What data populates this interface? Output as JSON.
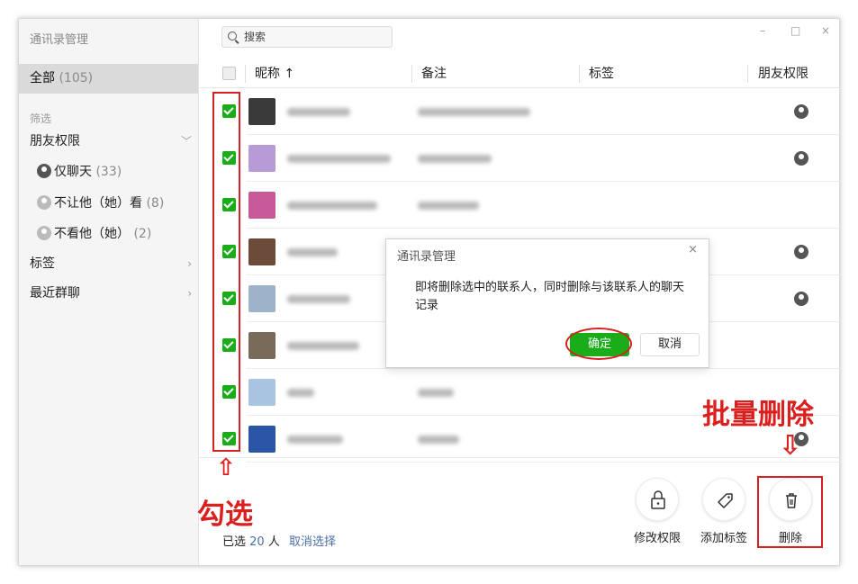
{
  "sidebar": {
    "title": "通讯录管理",
    "all_label": "全部",
    "all_count": "(105)",
    "filter_label": "筛选",
    "friend_perm": "朋友权限",
    "only_chat": "仅聊天",
    "only_chat_count": "(33)",
    "no_let_see": "不让他（她）看",
    "no_let_see_count": "(8)",
    "no_see": "不看他（她）",
    "no_see_count": "(2)",
    "tags": "标签",
    "recent_groups": "最近群聊"
  },
  "search": {
    "placeholder": "搜索"
  },
  "window_controls": {
    "minimize": "–",
    "maximize": "□",
    "close": "×"
  },
  "table": {
    "columns": [
      "昵称 ↑",
      "备注",
      "标签",
      "朋友权限"
    ],
    "rows": [
      {
        "avatar_color": "#3a3a3a",
        "chat_only": true
      },
      {
        "avatar_color": "#b79ad6",
        "chat_only": true
      },
      {
        "avatar_color": "#c85a9a",
        "chat_only": false
      },
      {
        "avatar_color": "#6b4b3a",
        "chat_only": true
      },
      {
        "avatar_color": "#9db3c9",
        "chat_only": true
      },
      {
        "avatar_color": "#7a6a5a",
        "chat_only": false
      },
      {
        "avatar_color": "#a8c4e0",
        "chat_only": false
      },
      {
        "avatar_color": "#2b56a6",
        "chat_only": true
      }
    ]
  },
  "footer": {
    "selected_prefix": "已选",
    "selected_count": "20",
    "selected_suffix": "人",
    "cancel_selection": "取消选择",
    "action_modify": "修改权限",
    "action_add_tag": "添加标签",
    "action_delete": "删除"
  },
  "dialog": {
    "title": "通讯录管理",
    "close": "×",
    "message": "即将删除选中的联系人，同时删除与该联系人的聊天记录",
    "confirm": "确定",
    "cancel": "取消"
  },
  "annotations": {
    "select_label": "勾选",
    "batch_delete_label": "批量删除",
    "up_arrow": "⇧",
    "down_arrow": "⇩",
    "color": "#d9201f"
  }
}
